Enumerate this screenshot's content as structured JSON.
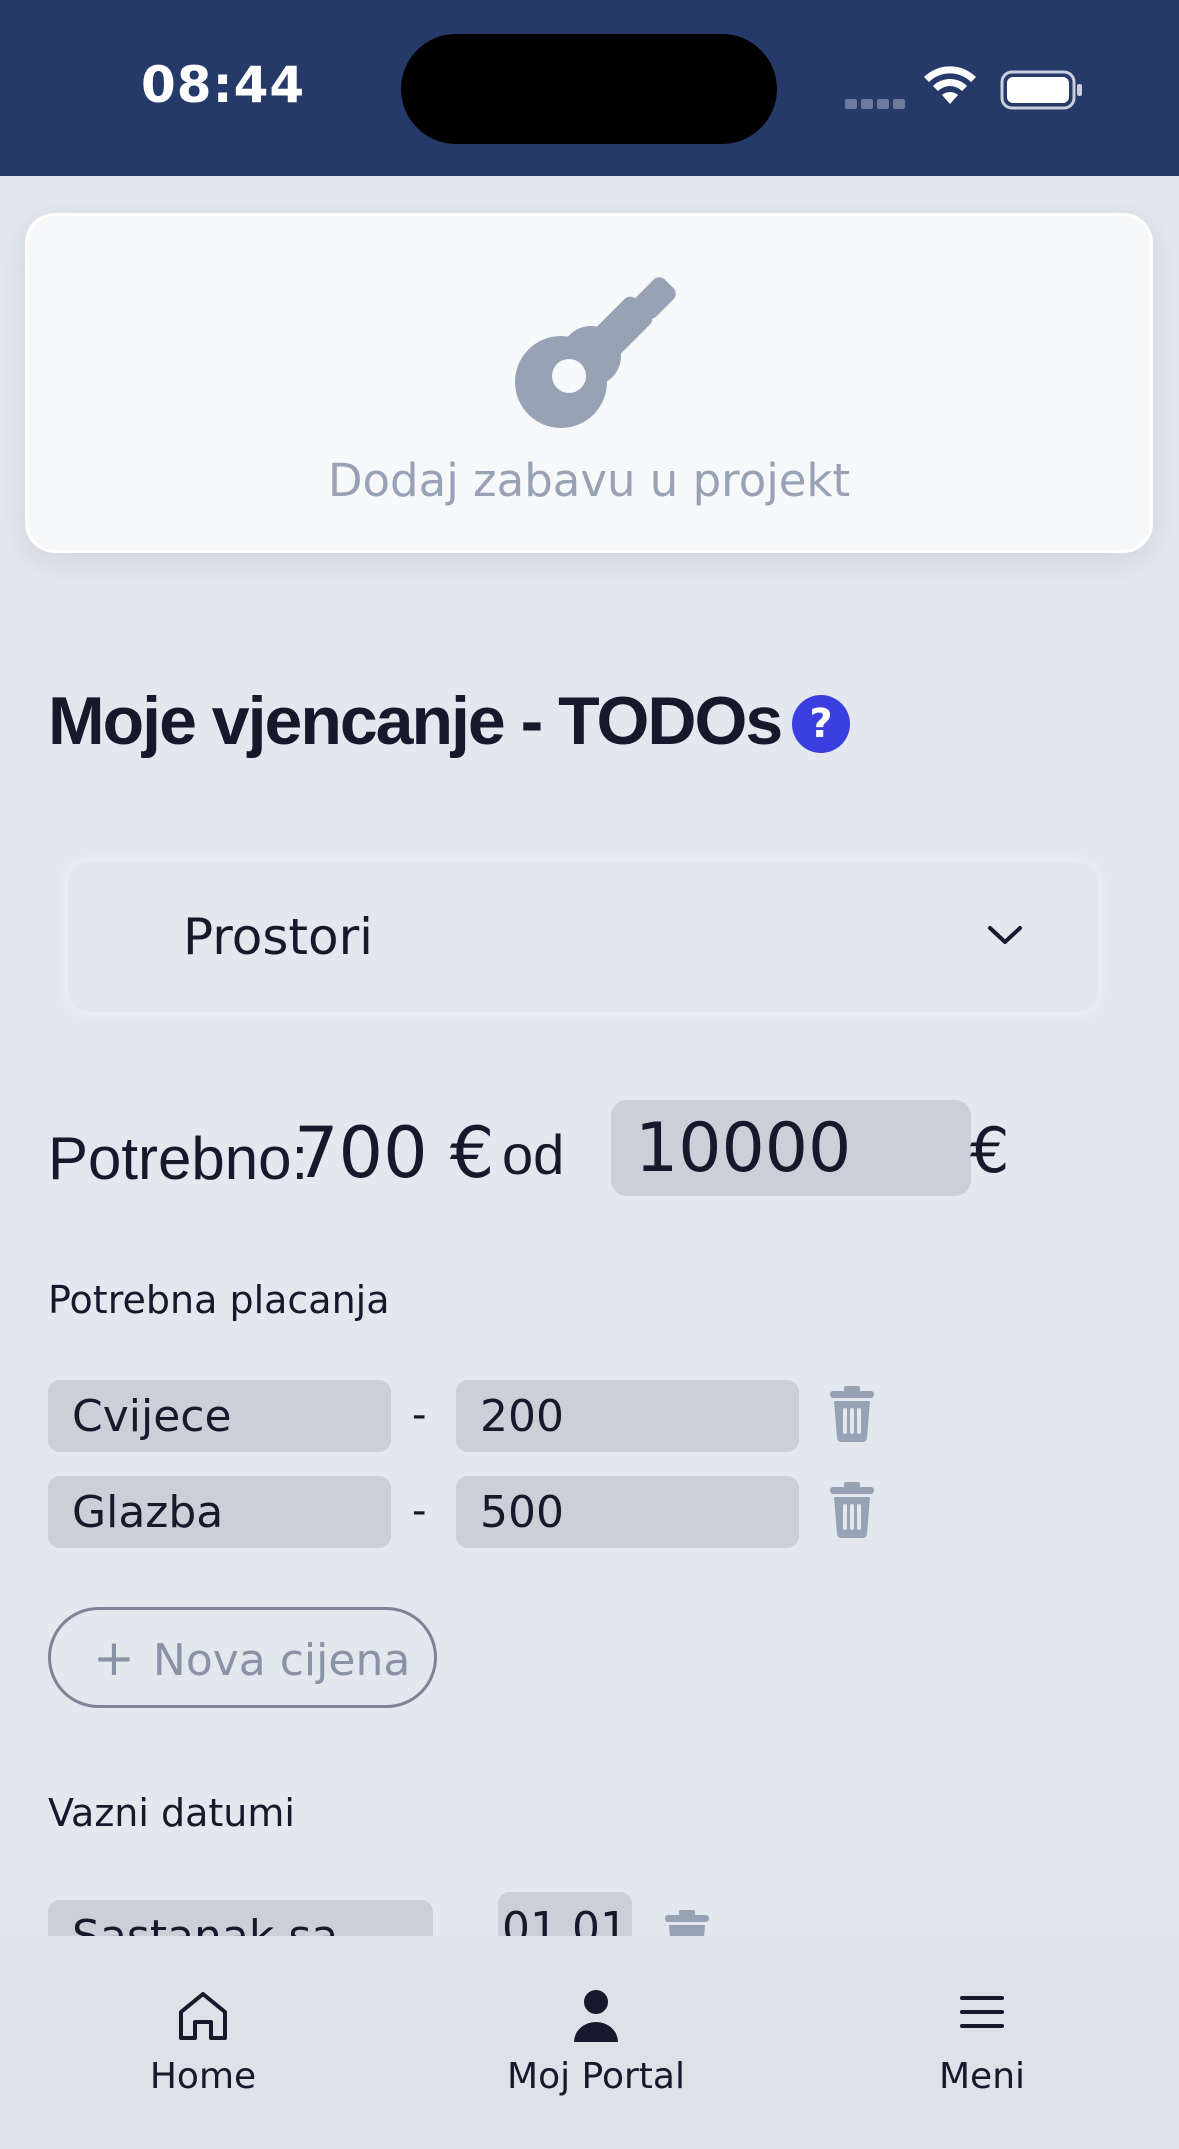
{
  "status_bar": {
    "time": "08:44"
  },
  "entertainment_card": {
    "label": "Dodaj zabavu u projekt",
    "icon": "guitar-icon"
  },
  "page": {
    "title": "Moje vjencanje - TODOs",
    "help": "?"
  },
  "category_dropdown": {
    "selected": "Prostori"
  },
  "budget": {
    "needed_label": "Potrebno:",
    "needed_amount": "700 €",
    "of_label": "od",
    "total_value": "10000",
    "currency": "€"
  },
  "payments": {
    "label": "Potrebna placanja",
    "separator": "-",
    "items": [
      {
        "name": "Cvijece",
        "amount": "200"
      },
      {
        "name": "Glazba",
        "amount": "500"
      }
    ],
    "add_button_label": "Nova cijena",
    "add_button_icon": "+"
  },
  "dates": {
    "label": "Vazni datumi",
    "items": [
      {
        "name": "Sastanak sa",
        "date": "01.01"
      }
    ]
  },
  "bottom_nav": {
    "items": [
      {
        "label": "Home",
        "icon": "home-icon"
      },
      {
        "label": "Moj Portal",
        "icon": "person-icon"
      },
      {
        "label": "Meni",
        "icon": "menu-icon"
      }
    ]
  },
  "colors": {
    "status_bar": "#263a6a",
    "background": "#e3e7ee",
    "accent": "#3b3fe0",
    "field": "#cbcfd7",
    "muted": "#98a2b5"
  }
}
